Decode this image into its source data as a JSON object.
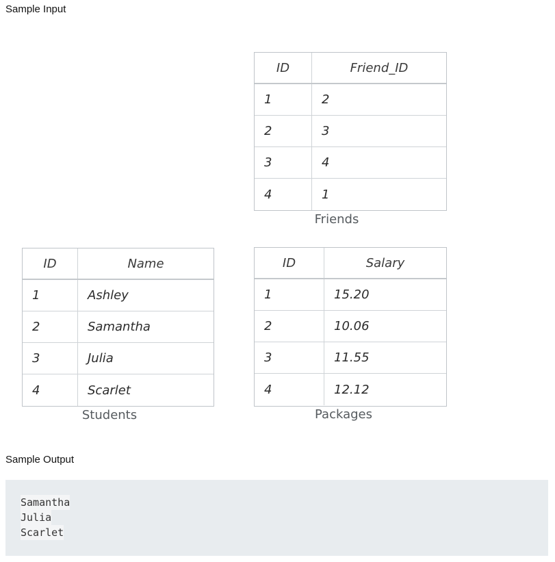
{
  "sample_input_heading": "Sample Input",
  "sample_output_heading": "Sample Output",
  "friends": {
    "caption": "Friends",
    "headers": [
      "ID",
      "Friend_ID"
    ],
    "rows": [
      [
        "1",
        "2"
      ],
      [
        "2",
        "3"
      ],
      [
        "3",
        "4"
      ],
      [
        "4",
        "1"
      ]
    ]
  },
  "students": {
    "caption": "Students",
    "headers": [
      "ID",
      "Name"
    ],
    "rows": [
      [
        "1",
        "Ashley"
      ],
      [
        "2",
        "Samantha"
      ],
      [
        "3",
        "Julia"
      ],
      [
        "4",
        "Scarlet"
      ]
    ]
  },
  "packages": {
    "caption": "Packages",
    "headers": [
      "ID",
      "Salary"
    ],
    "rows": [
      [
        "1",
        "15.20"
      ],
      [
        "2",
        "10.06"
      ],
      [
        "3",
        "11.55"
      ],
      [
        "4",
        "12.12"
      ]
    ]
  },
  "sample_output_lines": [
    "Samantha",
    "Julia",
    "Scarlet"
  ]
}
